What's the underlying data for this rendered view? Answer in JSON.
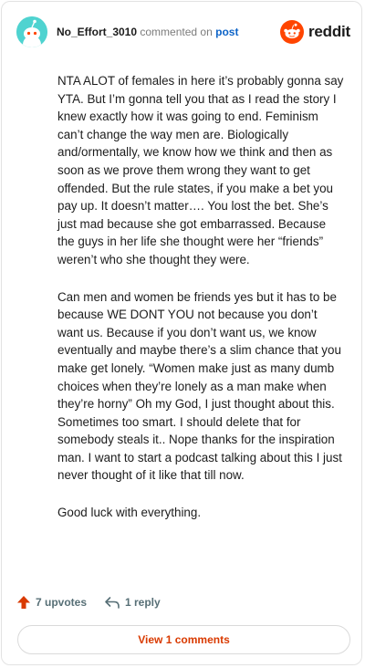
{
  "header": {
    "username": "No_Effort_3010",
    "action_text": "commented on",
    "post_link": "post",
    "brand_name": "reddit"
  },
  "comment": {
    "paragraphs": [
      "NTA ALOT of females in here it’s probably gonna say YTA. But I’m gonna tell you that as I read the story I knew exactly how it was going to end. Feminism can’t change the way men are. Biologically and/ormentally, we know how we think and then as soon as we prove them wrong they want to get offended. But the rule states, if you make a bet you pay up. It doesn’t matter…. You lost the bet. She’s just mad because she got embarrassed. Because the guys in her life she thought were her “friends” weren’t who she thought they were.",
      "Can men and women be friends yes but it has to be because WE DONT YOU not because you don’t want us. Because if you don’t want us, we know eventually and maybe there’s a slim chance that you make get lonely. “Women make just as many dumb choices when they’re lonely as a man make when they’re horny” Oh my God, I just thought about this. Sometimes too smart. I should delete that for somebody steals it.. Nope thanks for the inspiration man. I want to start a podcast talking about this I just never thought of it like that till now.",
      "Good luck with everything."
    ]
  },
  "footer": {
    "upvotes_label": "7 upvotes",
    "reply_label": "1 reply",
    "view_comments_label": "View 1 comments"
  },
  "colors": {
    "avatar": "#4fd3d0",
    "reddit_orange": "#ff4500",
    "upvote_arrow": "#d93a00",
    "link_blue": "#0e64c8",
    "muted": "#576f76"
  },
  "icons": [
    "avatar-snoo-icon",
    "reddit-logo-icon",
    "upvote-arrow-icon",
    "reply-arrow-icon"
  ]
}
